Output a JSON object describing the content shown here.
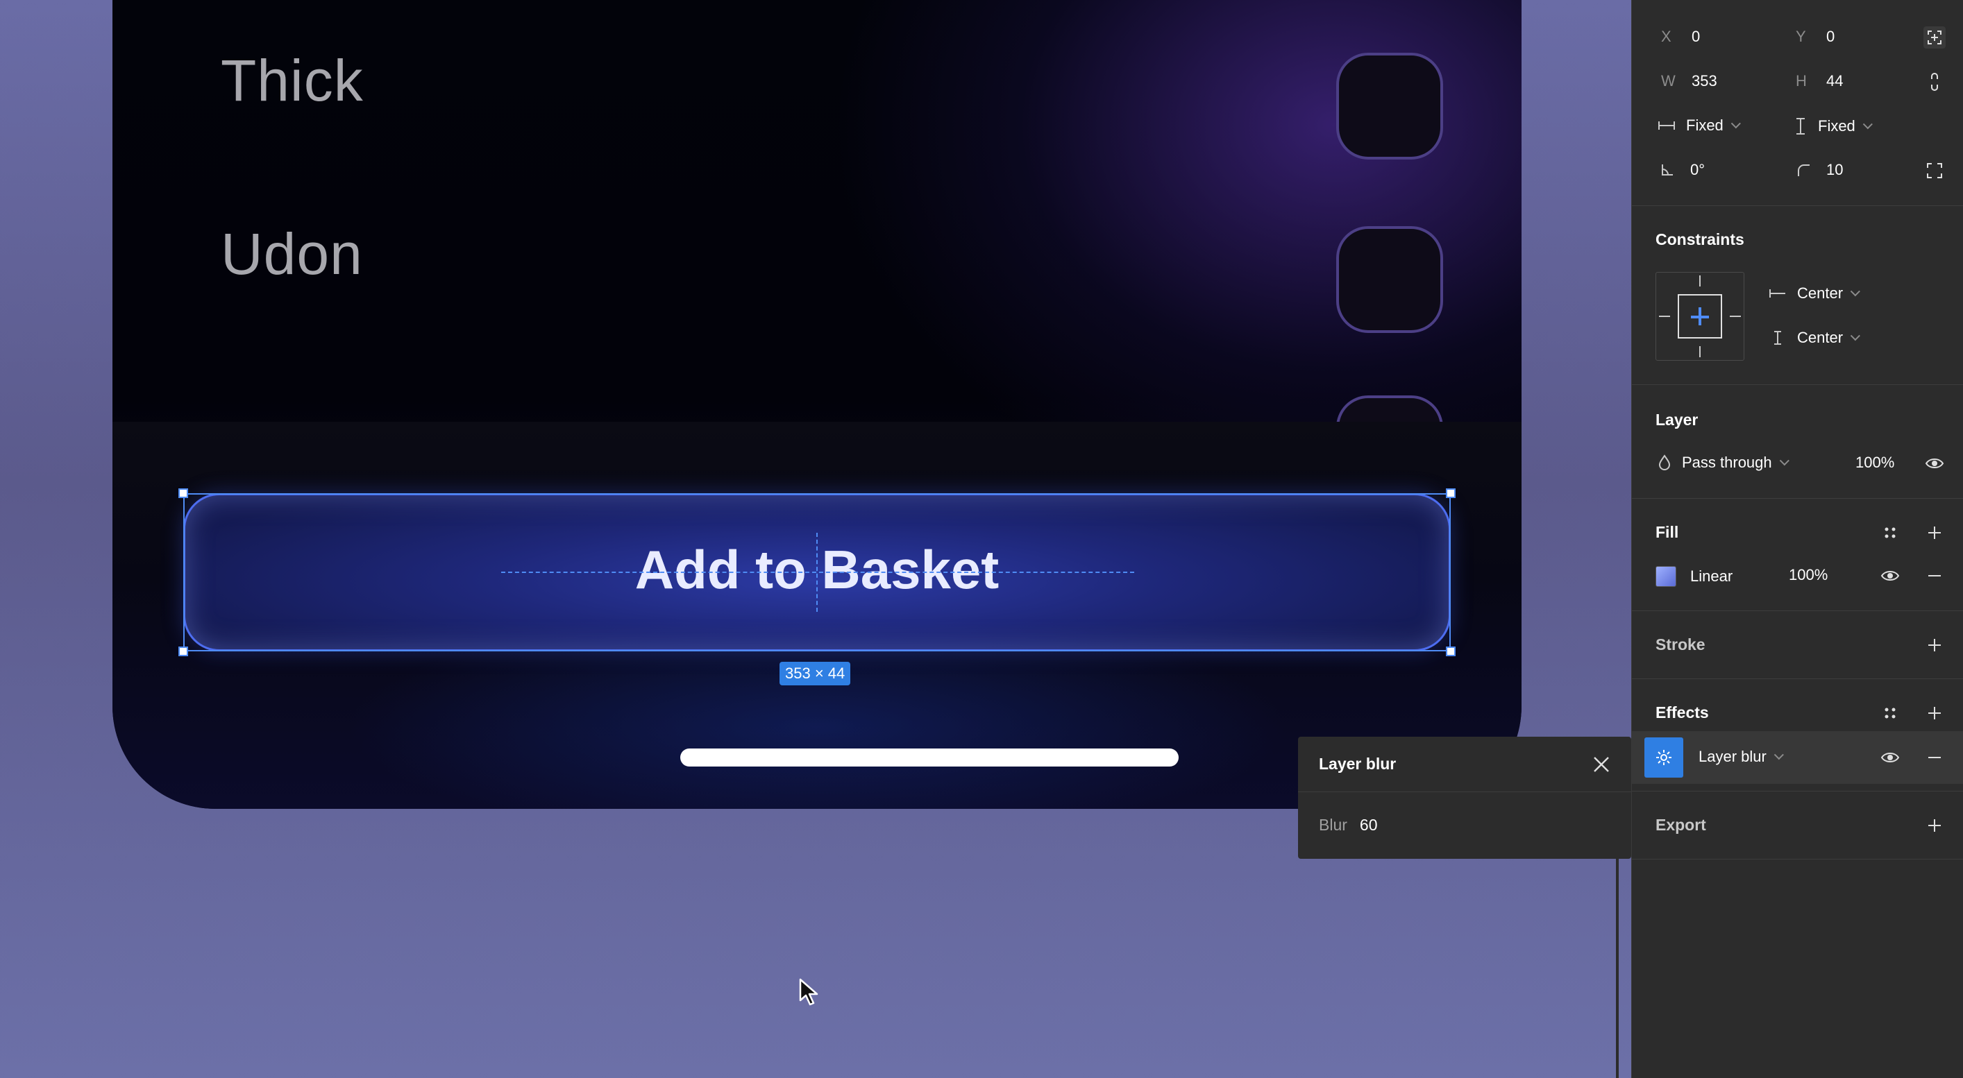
{
  "canvas": {
    "rows": [
      {
        "label": "Thick"
      },
      {
        "label": "Udon"
      }
    ],
    "button_label": "Add to Basket",
    "size_badge": "353 × 44"
  },
  "popover": {
    "title": "Layer blur",
    "blur_label": "Blur",
    "blur_value": "60"
  },
  "panel": {
    "x_label": "X",
    "x_value": "0",
    "y_label": "Y",
    "y_value": "0",
    "w_label": "W",
    "w_value": "353",
    "h_label": "H",
    "h_value": "44",
    "width_sizing": "Fixed",
    "height_sizing": "Fixed",
    "rotation": "0°",
    "corner_radius": "10",
    "constraints": {
      "title": "Constraints",
      "horizontal": "Center",
      "vertical": "Center"
    },
    "layer": {
      "title": "Layer",
      "blend_mode": "Pass through",
      "opacity": "100%"
    },
    "fill": {
      "title": "Fill",
      "type": "Linear",
      "opacity": "100%"
    },
    "stroke": {
      "title": "Stroke"
    },
    "effects": {
      "title": "Effects",
      "effect_name": "Layer blur"
    },
    "export": {
      "title": "Export"
    }
  },
  "colors": {
    "selection": "#4f8cf5",
    "panel_bg": "#2c2c2c",
    "accent": "#2f7fe3"
  }
}
